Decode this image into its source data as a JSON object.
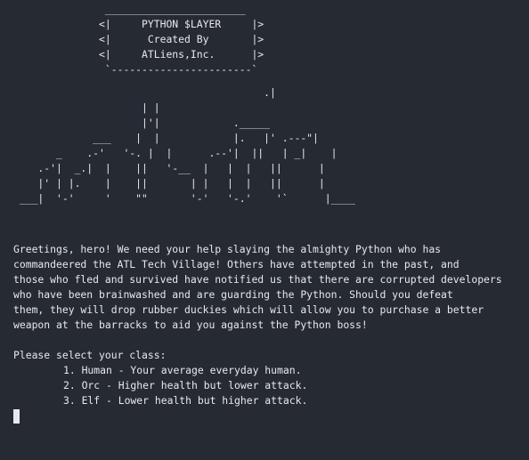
{
  "banner": {
    "art": "               _______________________\n              <|     PYTHON $LAYER     |>\n              <|      Created By       |>\n              <|     ATLiens,Inc.      |>\n               `-----------------------`"
  },
  "skyline": {
    "art": "                                         .|\n                     | |\n                     |'|            ._____\n             ___    |  |            |.   |' .---\"|\n       _    .-'   '-. |  |      .--'|  ||   | _|    |\n    .-'|  _.|  |    ||   '-__  |   |  |   ||      |\n    |' | |.    |    ||       | |   |  |   ||      |\n ___|  '-'     '    \"\"       '-'   '-.'    '`      |____"
  },
  "story": {
    "lines": [
      "Greetings, hero! We need your help slaying the almighty Python who has",
      "commandeered the ATL Tech Village! Others have attempted in the past, and",
      "those who fled and survived have notified us that there are corrupted developers",
      "who have been brainwashed and are guarding the Python. Should you defeat",
      "them, they will drop rubber duckies which will allow you to purchase a better",
      "weapon at the barracks to aid you against the Python boss!"
    ]
  },
  "prompt": {
    "text": "Please select your class:",
    "options": [
      "1. Human - Your average everyday human.",
      "2. Orc - Higher health but lower attack.",
      "3. Elf - Lower health but higher attack."
    ]
  }
}
